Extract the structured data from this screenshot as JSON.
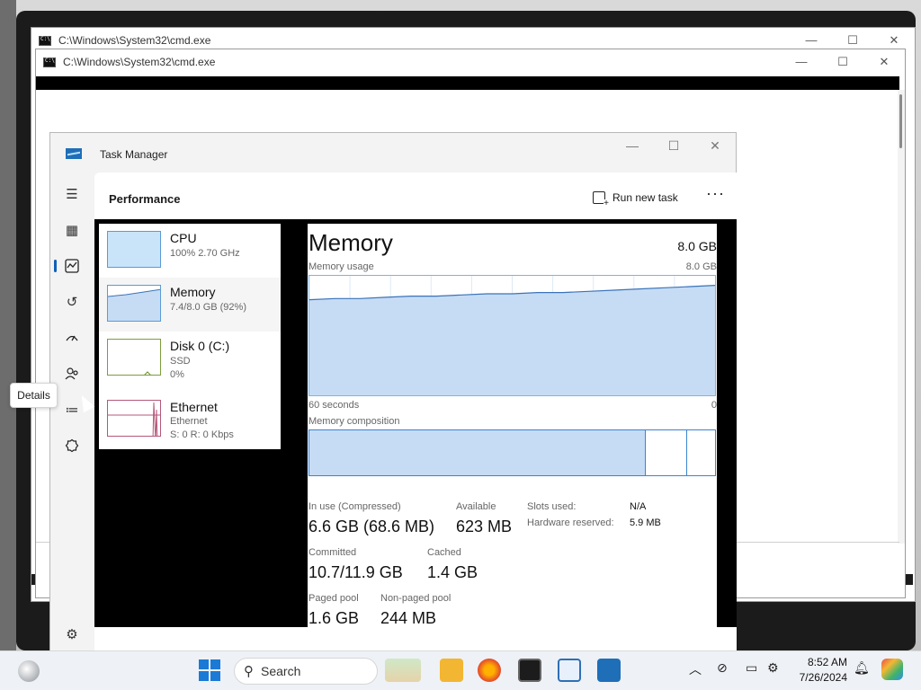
{
  "cmd_windows": [
    {
      "title": "C:\\Windows\\System32\\cmd.exe"
    },
    {
      "title": "C:\\Windows\\System32\\cmd.exe"
    }
  ],
  "window_controls": {
    "minimize": "—",
    "maximize": "☐",
    "close": "✕"
  },
  "task_manager": {
    "title": "Task Manager",
    "page_title": "Performance",
    "run_new_task": "Run new task",
    "more": "···",
    "tooltip": "Details",
    "nav_icons": [
      "hamburger-icon",
      "processes-icon",
      "performance-icon",
      "app-history-icon",
      "startup-apps-icon",
      "users-icon",
      "details-icon",
      "services-icon",
      "settings-icon"
    ]
  },
  "performance_list": [
    {
      "name": "CPU",
      "sub1": "100%  2.70 GHz",
      "sub2": ""
    },
    {
      "name": "Memory",
      "sub1": "7.4/8.0 GB (92%)",
      "sub2": ""
    },
    {
      "name": "Disk 0 (C:)",
      "sub1": "SSD",
      "sub2": "0%"
    },
    {
      "name": "Ethernet",
      "sub1": "Ethernet",
      "sub2": "S: 0  R: 0 Kbps"
    }
  ],
  "memory": {
    "title": "Memory",
    "total": "8.0 GB",
    "usage_label": "Memory usage",
    "usage_max": "8.0 GB",
    "time_label": "60 seconds",
    "time_end": "0",
    "composition_label": "Memory composition",
    "usage_series_percent": [
      80,
      81,
      81,
      82,
      83,
      83,
      84,
      85,
      85,
      86,
      86,
      87,
      88,
      89,
      90,
      91,
      92
    ],
    "composition": {
      "in_use_fraction": 0.83,
      "cached_fraction": 0.1
    }
  },
  "stats": {
    "in_use_label": "In use (Compressed)",
    "in_use_value": "6.6 GB (68.6 MB)",
    "available_label": "Available",
    "available_value": "623 MB",
    "slots_label": "Slots used:",
    "slots_value": "N/A",
    "hw_reserved_label": "Hardware reserved:",
    "hw_reserved_value": "5.9 MB",
    "committed_label": "Committed",
    "committed_value": "10.7/11.9 GB",
    "cached_label": "Cached",
    "cached_value": "1.4 GB",
    "paged_label": "Paged pool",
    "paged_value": "1.6 GB",
    "nonpaged_label": "Non-paged pool",
    "nonpaged_value": "244 MB"
  },
  "taskbar": {
    "search_placeholder": "Search",
    "time": "8:52 AM",
    "date": "7/26/2024"
  }
}
